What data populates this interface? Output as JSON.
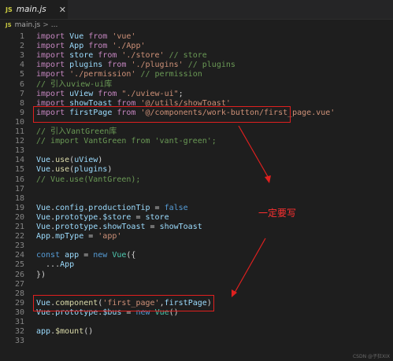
{
  "tab": {
    "badge": "JS",
    "filename": "main.js",
    "close_glyph": "✕"
  },
  "breadcrumb": {
    "badge": "JS",
    "file": "main.js",
    "sep": ">",
    "more": "..."
  },
  "lines": [
    {
      "n": "1",
      "tokens": [
        {
          "t": "import ",
          "c": "kw"
        },
        {
          "t": "Vue",
          "c": "id"
        },
        {
          "t": " from ",
          "c": "kw"
        },
        {
          "t": "'vue'",
          "c": "str"
        }
      ]
    },
    {
      "n": "2",
      "tokens": [
        {
          "t": "import ",
          "c": "kw"
        },
        {
          "t": "App",
          "c": "id"
        },
        {
          "t": " from ",
          "c": "kw"
        },
        {
          "t": "'./App'",
          "c": "str"
        }
      ]
    },
    {
      "n": "3",
      "tokens": [
        {
          "t": "import ",
          "c": "kw"
        },
        {
          "t": "store",
          "c": "id"
        },
        {
          "t": " from ",
          "c": "kw"
        },
        {
          "t": "'./store'",
          "c": "str"
        },
        {
          "t": " // store",
          "c": "cm"
        }
      ]
    },
    {
      "n": "4",
      "tokens": [
        {
          "t": "import ",
          "c": "kw"
        },
        {
          "t": "plugins",
          "c": "id"
        },
        {
          "t": " from ",
          "c": "kw"
        },
        {
          "t": "'./plugins'",
          "c": "str"
        },
        {
          "t": " // plugins",
          "c": "cm"
        }
      ]
    },
    {
      "n": "5",
      "tokens": [
        {
          "t": "import ",
          "c": "kw"
        },
        {
          "t": "'./permission'",
          "c": "str"
        },
        {
          "t": " // permission",
          "c": "cm"
        }
      ]
    },
    {
      "n": "6",
      "tokens": [
        {
          "t": "// 引入uview-ui库",
          "c": "cm"
        }
      ]
    },
    {
      "n": "7",
      "tokens": [
        {
          "t": "import ",
          "c": "kw"
        },
        {
          "t": "uView",
          "c": "id"
        },
        {
          "t": " from ",
          "c": "kw"
        },
        {
          "t": "\"./uview-ui\"",
          "c": "str"
        },
        {
          "t": ";",
          "c": ""
        }
      ]
    },
    {
      "n": "8",
      "tokens": [
        {
          "t": "import ",
          "c": "kw"
        },
        {
          "t": "showToast",
          "c": "id"
        },
        {
          "t": " from ",
          "c": "kw"
        },
        {
          "t": "'@/utils/showToast'",
          "c": "str"
        }
      ]
    },
    {
      "n": "9",
      "tokens": [
        {
          "t": "import ",
          "c": "kw"
        },
        {
          "t": "firstPage",
          "c": "id"
        },
        {
          "t": " from ",
          "c": "kw"
        },
        {
          "t": "'@/components/work-button/first_page.vue'",
          "c": "str"
        }
      ]
    },
    {
      "n": "10",
      "tokens": []
    },
    {
      "n": "11",
      "tokens": [
        {
          "t": "// 引入VantGreen库",
          "c": "cm"
        }
      ]
    },
    {
      "n": "12",
      "tokens": [
        {
          "t": "// import VantGreen from 'vant-green';",
          "c": "cm"
        }
      ]
    },
    {
      "n": "13",
      "tokens": []
    },
    {
      "n": "14",
      "tokens": [
        {
          "t": "Vue",
          "c": "id"
        },
        {
          "t": ".",
          "c": ""
        },
        {
          "t": "use",
          "c": "fn"
        },
        {
          "t": "(",
          "c": ""
        },
        {
          "t": "uView",
          "c": "id"
        },
        {
          "t": ")",
          "c": ""
        }
      ]
    },
    {
      "n": "15",
      "tokens": [
        {
          "t": "Vue",
          "c": "id"
        },
        {
          "t": ".",
          "c": ""
        },
        {
          "t": "use",
          "c": "fn"
        },
        {
          "t": "(",
          "c": ""
        },
        {
          "t": "plugins",
          "c": "id"
        },
        {
          "t": ")",
          "c": ""
        }
      ]
    },
    {
      "n": "16",
      "tokens": [
        {
          "t": "// Vue.use(VantGreen);",
          "c": "cm"
        }
      ]
    },
    {
      "n": "17",
      "tokens": []
    },
    {
      "n": "18",
      "tokens": []
    },
    {
      "n": "19",
      "tokens": [
        {
          "t": "Vue",
          "c": "id"
        },
        {
          "t": ".",
          "c": ""
        },
        {
          "t": "config",
          "c": "id"
        },
        {
          "t": ".",
          "c": ""
        },
        {
          "t": "productionTip",
          "c": "id"
        },
        {
          "t": " = ",
          "c": ""
        },
        {
          "t": "false",
          "c": "bool"
        }
      ]
    },
    {
      "n": "20",
      "tokens": [
        {
          "t": "Vue",
          "c": "id"
        },
        {
          "t": ".",
          "c": ""
        },
        {
          "t": "prototype",
          "c": "id"
        },
        {
          "t": ".",
          "c": ""
        },
        {
          "t": "$store",
          "c": "id"
        },
        {
          "t": " = ",
          "c": ""
        },
        {
          "t": "store",
          "c": "id"
        }
      ]
    },
    {
      "n": "21",
      "tokens": [
        {
          "t": "Vue",
          "c": "id"
        },
        {
          "t": ".",
          "c": ""
        },
        {
          "t": "prototype",
          "c": "id"
        },
        {
          "t": ".",
          "c": ""
        },
        {
          "t": "showToast",
          "c": "id"
        },
        {
          "t": " = ",
          "c": ""
        },
        {
          "t": "showToast",
          "c": "id"
        }
      ]
    },
    {
      "n": "22",
      "tokens": [
        {
          "t": "App",
          "c": "id"
        },
        {
          "t": ".",
          "c": ""
        },
        {
          "t": "mpType",
          "c": "id"
        },
        {
          "t": " = ",
          "c": ""
        },
        {
          "t": "'app'",
          "c": "str"
        }
      ]
    },
    {
      "n": "23",
      "tokens": []
    },
    {
      "n": "24",
      "tokens": [
        {
          "t": "const ",
          "c": "bool"
        },
        {
          "t": "app",
          "c": "id"
        },
        {
          "t": " = ",
          "c": ""
        },
        {
          "t": "new ",
          "c": "bool"
        },
        {
          "t": "Vue",
          "c": "cls"
        },
        {
          "t": "({",
          "c": ""
        }
      ]
    },
    {
      "n": "25",
      "tokens": [
        {
          "t": "  ...",
          "c": ""
        },
        {
          "t": "App",
          "c": "id"
        }
      ]
    },
    {
      "n": "26",
      "tokens": [
        {
          "t": "})",
          "c": ""
        }
      ]
    },
    {
      "n": "27",
      "tokens": []
    },
    {
      "n": "28",
      "tokens": []
    },
    {
      "n": "29",
      "tokens": [
        {
          "t": "Vue",
          "c": "id"
        },
        {
          "t": ".",
          "c": ""
        },
        {
          "t": "component",
          "c": "fn"
        },
        {
          "t": "(",
          "c": ""
        },
        {
          "t": "'first_page'",
          "c": "str"
        },
        {
          "t": ",",
          "c": ""
        },
        {
          "t": "firstPage",
          "c": "id"
        },
        {
          "t": ")",
          "c": ""
        }
      ]
    },
    {
      "n": "30",
      "tokens": [
        {
          "t": "Vue",
          "c": "id"
        },
        {
          "t": ".",
          "c": ""
        },
        {
          "t": "prototype",
          "c": "id"
        },
        {
          "t": ".",
          "c": ""
        },
        {
          "t": "$bus",
          "c": "id"
        },
        {
          "t": " = ",
          "c": ""
        },
        {
          "t": "new ",
          "c": "bool"
        },
        {
          "t": "Vue",
          "c": "cls"
        },
        {
          "t": "()",
          "c": ""
        }
      ]
    },
    {
      "n": "31",
      "tokens": []
    },
    {
      "n": "32",
      "tokens": [
        {
          "t": "app",
          "c": "id"
        },
        {
          "t": ".",
          "c": ""
        },
        {
          "t": "$mount",
          "c": "fn"
        },
        {
          "t": "()",
          "c": ""
        }
      ]
    },
    {
      "n": "33",
      "tokens": []
    }
  ],
  "annotation": {
    "text": "一定要写",
    "color": "#ff3030"
  },
  "highlight_color": "#e0201f",
  "watermark": "CSDN @子狂XIX"
}
